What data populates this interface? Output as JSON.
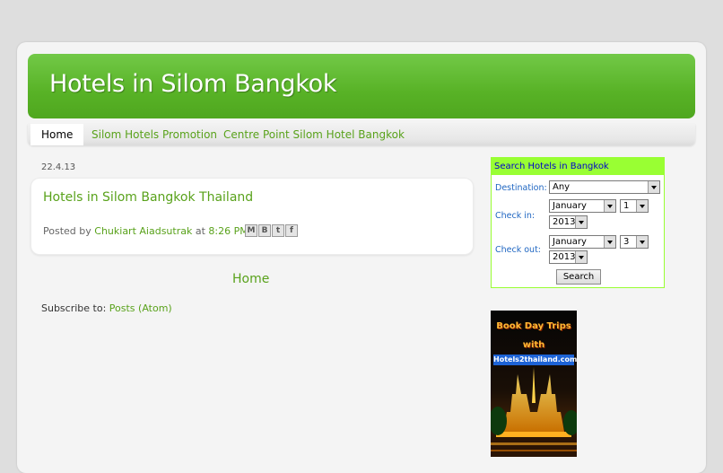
{
  "blog": {
    "title": "Hotels in Silom Bangkok"
  },
  "tabs": [
    {
      "label": "Home"
    },
    {
      "label": "Silom Hotels Promotion"
    },
    {
      "label": "Centre Point Silom Hotel Bangkok"
    }
  ],
  "post": {
    "date": "22.4.13",
    "title": "Hotels in Silom Bangkok Thailand",
    "posted_by": "Posted by",
    "author": "Chukiart Aiadsutrak",
    "at": "at",
    "time": "8:26 PM"
  },
  "share_icons": [
    "email-icon",
    "blogger-icon",
    "twitter-icon",
    "facebook-icon"
  ],
  "home_link": "Home",
  "subscribe": {
    "label": "Subscribe to:",
    "link": "Posts (Atom)"
  },
  "search_widget": {
    "title": "Search Hotels in Bangkok",
    "destination_label": "Destination:",
    "destination_value": "Any",
    "checkin_label": "Check in:",
    "checkin_month": "January",
    "checkin_day": "1",
    "checkin_year": "2013",
    "checkout_label": "Check out:",
    "checkout_month": "January",
    "checkout_day": "3",
    "checkout_year": "2013",
    "search_button": "Search"
  },
  "banner": {
    "line1": "Book Day Trips",
    "line2": "with",
    "line3": "Hotels2thailand.com"
  },
  "colors": {
    "accent_green": "#59a21b",
    "header_green": "#58b226",
    "widget_lime": "#99ff33",
    "widget_title_blue": "#0000cc"
  }
}
